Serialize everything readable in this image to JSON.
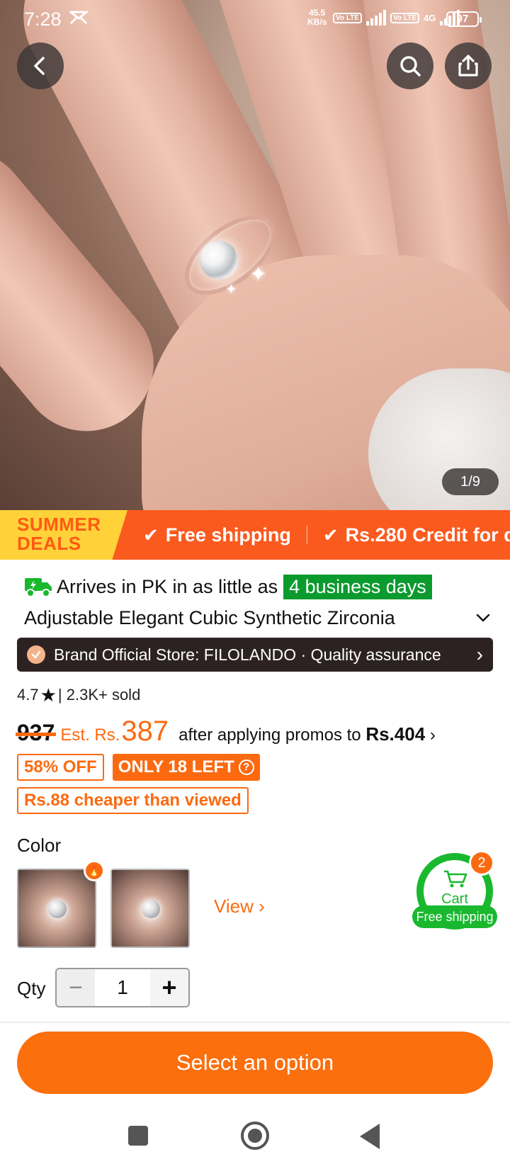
{
  "status_bar": {
    "time": "7:28",
    "network_speed_value": "45.5",
    "network_speed_unit": "KB/s",
    "volte": "Vo LTE",
    "network_type": "4G",
    "battery": "97"
  },
  "gallery": {
    "counter": "1/9"
  },
  "promo_banner": {
    "summer_line1": "SUMMER",
    "summer_line2": "DEALS",
    "item1": "Free shipping",
    "item2": "Rs.280 Credit for d"
  },
  "delivery": {
    "label": "Arrives in PK in as little as",
    "days": "4 business days"
  },
  "product": {
    "title": "Adjustable Elegant Cubic Synthetic Zirconia",
    "store": "Brand Official Store: FILOLANDO · Quality assurance",
    "rating": "4.7",
    "sold": "| 2.3K+ sold"
  },
  "price": {
    "original": "937",
    "est_label": "Est. Rs.",
    "est_value": "387",
    "after_text": "after applying promos to",
    "after_value": "Rs.404",
    "discount_tag": "58% OFF",
    "stock_tag": "ONLY 18 LEFT",
    "cheaper_tag": "Rs.88 cheaper than viewed"
  },
  "options": {
    "color_label": "Color",
    "view_label": "View"
  },
  "cart": {
    "label": "Cart",
    "count": "2",
    "free_shipping": "Free shipping"
  },
  "quantity": {
    "label": "Qty",
    "value": "1",
    "minus": "−",
    "plus": "+"
  },
  "cta": {
    "label": "Select an option"
  },
  "colors": {
    "accent": "#fb6a10",
    "green": "#19b82e",
    "store_bg": "#2d2222"
  }
}
